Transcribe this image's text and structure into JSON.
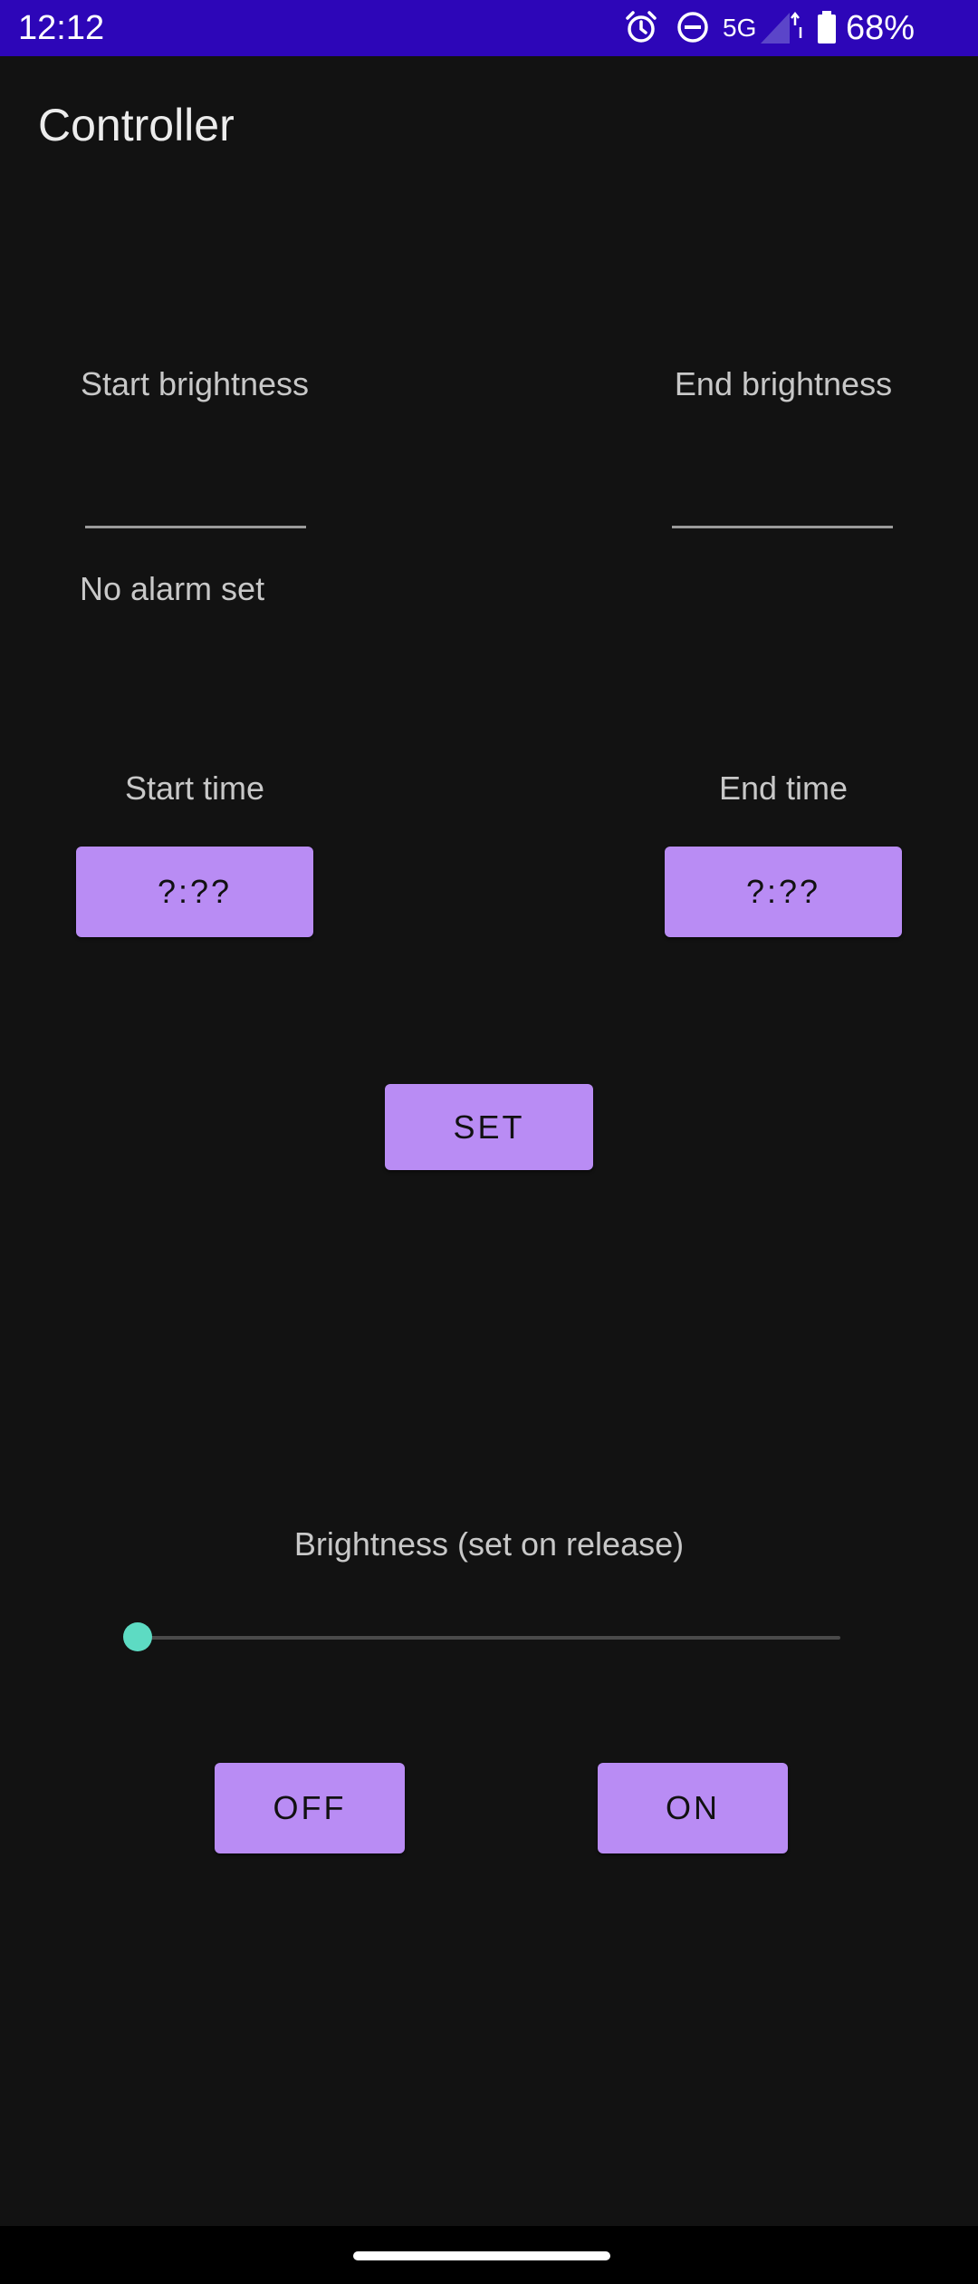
{
  "status_bar": {
    "time": "12:12",
    "network": "5G",
    "battery": "68%",
    "icons": [
      "alarm-icon",
      "do-not-disturb-icon",
      "signal-icon",
      "battery-icon"
    ],
    "color": "#2d06b8"
  },
  "app_bar": {
    "title": "Controller"
  },
  "brightness_fields": {
    "start_label": "Start brightness",
    "start_value": "",
    "end_label": "End brightness",
    "end_value": ""
  },
  "alarm_status": "No alarm set",
  "time_pickers": {
    "start_label": "Start time",
    "start_value": "?:??",
    "end_label": "End time",
    "end_value": "?:??"
  },
  "set_button": "SET",
  "brightness_slider": {
    "label": "Brightness (set on release)",
    "value": 0,
    "min": 0,
    "max": 1
  },
  "power_buttons": {
    "off": "OFF",
    "on": "ON"
  },
  "colors": {
    "background": "#121212",
    "accent": "#b98cf4",
    "slider_thumb": "#5ddbc3"
  }
}
